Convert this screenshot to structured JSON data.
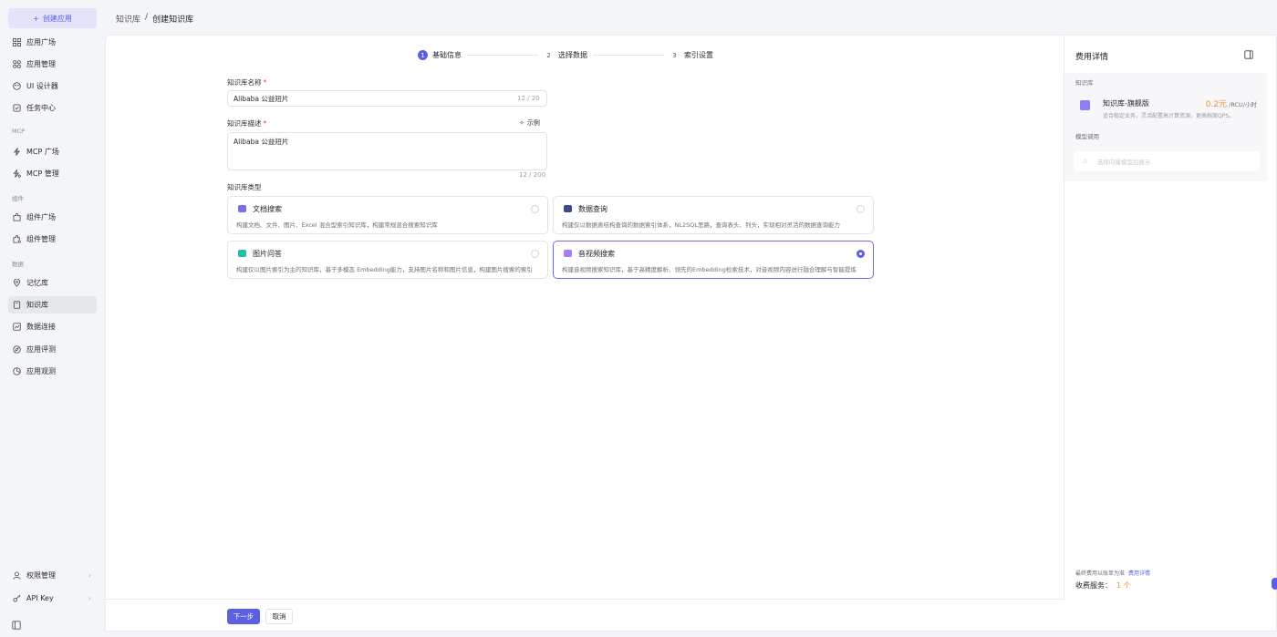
{
  "sidebar": {
    "create_label": "创建应用",
    "items": [
      {
        "label": "应用广场",
        "icon": "grid-icon"
      },
      {
        "label": "应用管理",
        "icon": "apps-icon"
      },
      {
        "label": "UI 设计器",
        "icon": "palette-icon"
      },
      {
        "label": "任务中心",
        "icon": "task-icon"
      },
      {
        "label": "MCP 广场",
        "icon": "bolt-icon"
      },
      {
        "label": "MCP 管理",
        "icon": "bolt-settings-icon"
      },
      {
        "label": "组件广场",
        "icon": "puzzle-icon"
      },
      {
        "label": "组件管理",
        "icon": "puzzle-settings-icon"
      },
      {
        "label": "记忆库",
        "icon": "memory-icon"
      },
      {
        "label": "知识库",
        "icon": "book-icon"
      },
      {
        "label": "数据连接",
        "icon": "chart-icon"
      },
      {
        "label": "应用评测",
        "icon": "compass-icon"
      },
      {
        "label": "应用观测",
        "icon": "pie-icon"
      }
    ],
    "groups": {
      "mcp": "MCP",
      "components": "组件",
      "data": "数据"
    },
    "bottom": [
      {
        "label": "权限管理",
        "icon": "user-icon"
      },
      {
        "label": "API Key",
        "icon": "key-icon"
      }
    ]
  },
  "breadcrumb": {
    "root": "知识库",
    "sep": "/",
    "current": "创建知识库"
  },
  "steps": [
    {
      "num": "1",
      "label": "基础信息"
    },
    {
      "num": "2",
      "label": "选择数据"
    },
    {
      "num": "3",
      "label": "索引设置"
    }
  ],
  "form": {
    "name_label": "知识库名称",
    "name_value": "Alibaba 公益短片",
    "name_counter": "12 / 20",
    "desc_label": "知识库描述",
    "example_label": "示例",
    "desc_value": "Alibaba 公益短片",
    "desc_counter": "12 / 200",
    "type_label": "知识库类型",
    "required": "*"
  },
  "types": [
    {
      "title": "文档搜索",
      "desc": "构建文档、文件、图片、Excel 混合型索引知识库，构建常规混合搜索知识库",
      "icon_color": "#7a6df0",
      "selected": false
    },
    {
      "title": "数据查询",
      "desc": "构建仅以数据表结构查询的数据索引体系，NL2SQL思路，查询表头、列头，实现相对灵活的数据查询能力",
      "icon_color": "#3b4a8a",
      "selected": false
    },
    {
      "title": "图片问答",
      "desc": "构建仅以图片索引为主的知识库，基于多模态 Embedding能力，支持图片名称和图片信息，构建图片搜索的索引",
      "icon_color": "#20c1a8",
      "selected": false
    },
    {
      "title": "音视频搜索",
      "desc": "构建音视频搜索知识库，基于高精度解析、领先的Embedding检索技术，对音视频内容进行融合理解与智能提炼",
      "icon_color": "#a77df0",
      "selected": true
    }
  ],
  "footer": {
    "next": "下一步",
    "cancel": "取消"
  },
  "fees": {
    "title": "费用详情",
    "kb_section": "知识库",
    "product_name": "知识库-旗舰版",
    "price": "0.2元",
    "price_unit": "/RCU/小时",
    "product_desc": "适合稳定业务，灵活配置高计算资源，更高档案QPS。",
    "model_section": "模型调用",
    "model_placeholder": "选择向量模型后展示",
    "final_note": "最终费用以账单为准",
    "fee_link": "费用详情",
    "charge_label": "收费服务：",
    "charge_count": "1 个"
  }
}
